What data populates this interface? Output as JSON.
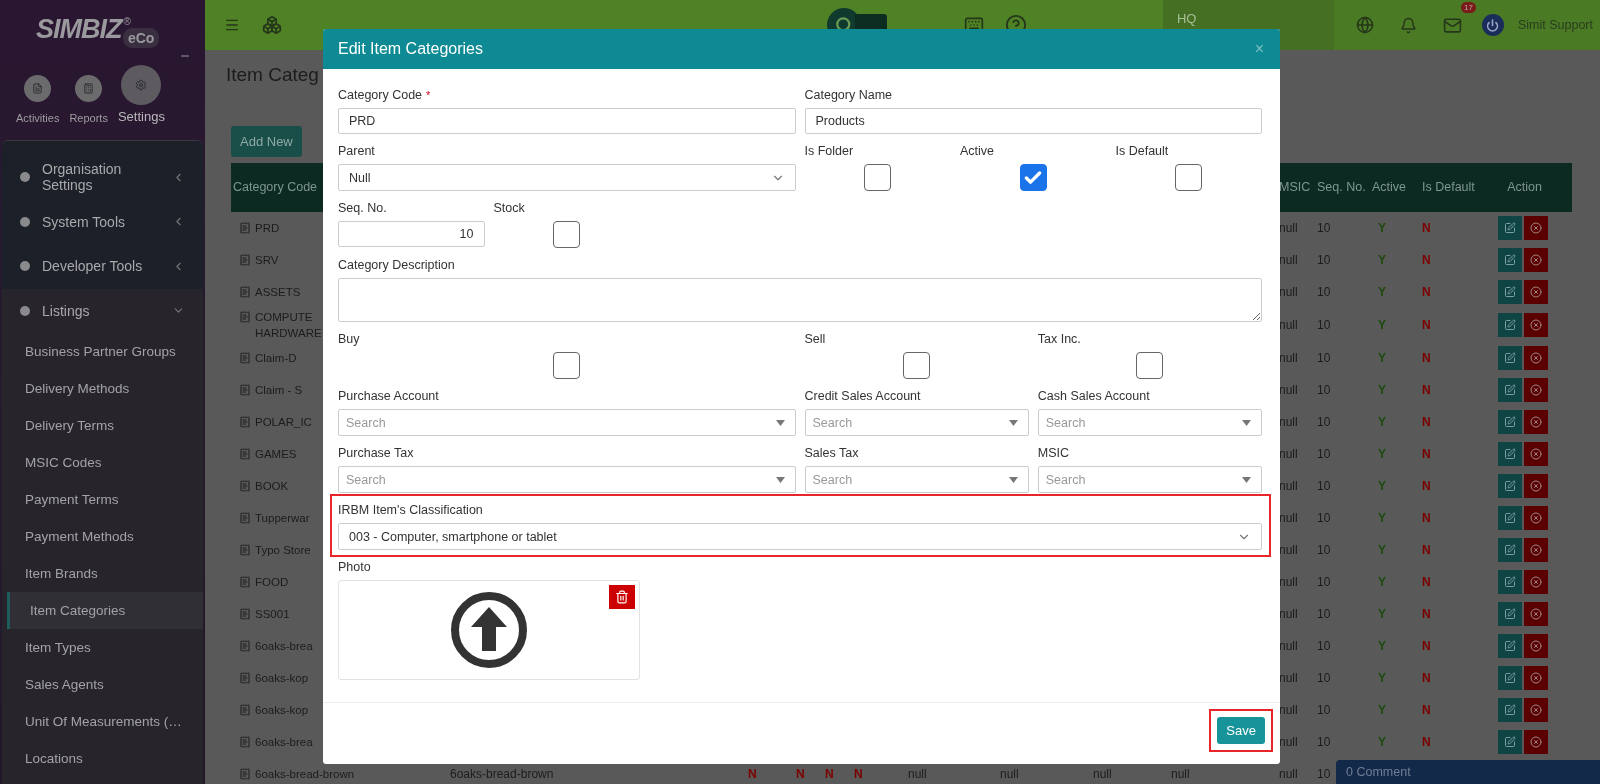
{
  "sidebar": {
    "logo": {
      "name": "SIMBIZ",
      "mark": "®",
      "suffix": "eCo"
    },
    "modules": [
      {
        "label": "Activities",
        "selected": false
      },
      {
        "label": "Reports",
        "selected": false
      },
      {
        "label": "Settings",
        "selected": true
      }
    ],
    "menu": [
      {
        "label": "Organisation Settings",
        "expanded": false
      },
      {
        "label": "System Tools",
        "expanded": false
      },
      {
        "label": "Developer Tools",
        "expanded": false
      },
      {
        "label": "Listings",
        "expanded": true,
        "children": [
          {
            "label": "Business Partner Groups",
            "selected": false
          },
          {
            "label": "Delivery Methods",
            "selected": false
          },
          {
            "label": "Delivery Terms",
            "selected": false
          },
          {
            "label": "MSIC Codes",
            "selected": false
          },
          {
            "label": "Payment Terms",
            "selected": false
          },
          {
            "label": "Payment Methods",
            "selected": false
          },
          {
            "label": "Item Brands",
            "selected": false
          },
          {
            "label": "Item Categories",
            "selected": true
          },
          {
            "label": "Item Types",
            "selected": false
          },
          {
            "label": "Sales Agents",
            "selected": false
          },
          {
            "label": "Unit Of Measurements (…",
            "selected": false
          },
          {
            "label": "Locations",
            "selected": false
          }
        ]
      }
    ]
  },
  "topbar": {
    "location": "HQ",
    "mail_count": "17",
    "user": "Simit Support"
  },
  "page": {
    "title": "Item Categ",
    "add_button": "Add New"
  },
  "table": {
    "columns": [
      "Category Code",
      "MSIC",
      "Seq. No.",
      "Active",
      "Is Default",
      "Action"
    ],
    "rows": [
      {
        "kind": "partial",
        "code": "PRD",
        "msic": "null",
        "seq": "10",
        "active": "Y",
        "is_default": "N"
      },
      {
        "kind": "partial",
        "code": "SRV",
        "msic": "null",
        "seq": "10",
        "active": "Y",
        "is_default": "N"
      },
      {
        "kind": "partial",
        "code": "ASSETS",
        "msic": "null",
        "seq": "10",
        "active": "Y",
        "is_default": "N"
      },
      {
        "kind": "partial",
        "code": "COMPUTE HARDWARE",
        "msic": "null",
        "seq": "10",
        "active": "Y",
        "is_default": "N"
      },
      {
        "kind": "partial",
        "code": "Claim-D",
        "msic": "null",
        "seq": "10",
        "active": "Y",
        "is_default": "N"
      },
      {
        "kind": "partial",
        "code": "Claim - S",
        "msic": "null",
        "seq": "10",
        "active": "Y",
        "is_default": "N"
      },
      {
        "kind": "partial",
        "code": "POLAR_IC",
        "msic": "null",
        "seq": "10",
        "active": "Y",
        "is_default": "N"
      },
      {
        "kind": "partial",
        "code": "GAMES",
        "msic": "null",
        "seq": "10",
        "active": "Y",
        "is_default": "N"
      },
      {
        "kind": "partial",
        "code": "BOOK",
        "msic": "null",
        "seq": "10",
        "active": "Y",
        "is_default": "N"
      },
      {
        "kind": "partial",
        "code": "Tupperwar",
        "msic": "null",
        "seq": "10",
        "active": "Y",
        "is_default": "N"
      },
      {
        "kind": "partial",
        "code": "Typo Store",
        "msic": "null",
        "seq": "10",
        "active": "Y",
        "is_default": "N"
      },
      {
        "kind": "partial",
        "code": "FOOD",
        "msic": "null",
        "seq": "10",
        "active": "Y",
        "is_default": "N"
      },
      {
        "kind": "partial",
        "code": "SS001",
        "msic": "null",
        "seq": "10",
        "active": "Y",
        "is_default": "N"
      },
      {
        "kind": "partial",
        "code": "6oaks-brea",
        "msic": "null",
        "seq": "10",
        "active": "Y",
        "is_default": "N"
      },
      {
        "kind": "partial",
        "code": "6oaks-kop",
        "msic": "null",
        "seq": "10",
        "active": "Y",
        "is_default": "N"
      },
      {
        "kind": "partial",
        "code": "6oaks-kop",
        "msic": "null",
        "seq": "10",
        "active": "Y",
        "is_default": "N"
      },
      {
        "kind": "partial",
        "code": "6oaks-brea",
        "msic": "null",
        "seq": "10",
        "active": "Y",
        "is_default": "N"
      },
      {
        "kind": "full",
        "code": "6oaks-bread-brown",
        "cells": [
          {
            "kind": "text",
            "text": "6oaks-bread-brown"
          },
          {
            "kind": "flag",
            "text": "N"
          },
          {
            "kind": "flag",
            "text": "N"
          },
          {
            "kind": "flag",
            "text": "N"
          },
          {
            "kind": "flag",
            "text": "N"
          },
          {
            "kind": "text",
            "text": "null"
          },
          {
            "kind": "text",
            "text": "null"
          },
          {
            "kind": "text",
            "text": "null"
          },
          {
            "kind": "text",
            "text": "null"
          }
        ],
        "msic": "null",
        "seq": "10"
      }
    ]
  },
  "modal": {
    "title": "Edit Item Categories",
    "close": "×",
    "rows": [
      {
        "fields": [
          {
            "kind": "text",
            "label": "Category Code",
            "required_mark": "*",
            "value": "PRD"
          },
          {
            "kind": "text",
            "label": "Category Name",
            "value": "Products"
          }
        ]
      },
      {
        "fields": [
          {
            "kind": "select",
            "label": "Parent",
            "value": "Null"
          },
          {
            "kind": "checkbox",
            "label": "Is Folder",
            "checked": false
          },
          {
            "kind": "checkbox",
            "label": "Active",
            "checked": true
          },
          {
            "kind": "checkbox",
            "label": "Is Default",
            "checked": false
          }
        ]
      },
      {
        "fields": [
          {
            "kind": "number",
            "label": "Seq. No.",
            "value": "10"
          },
          {
            "kind": "checkbox",
            "label": "Stock",
            "checked": false
          }
        ]
      },
      {
        "fields": [
          {
            "kind": "textarea",
            "label": "Category Description"
          }
        ]
      },
      {
        "fields": [
          {
            "kind": "checkbox",
            "label": "Buy",
            "checked": false
          },
          {
            "kind": "checkbox",
            "label": "Sell",
            "checked": false
          },
          {
            "kind": "checkbox",
            "label": "Tax Inc.",
            "checked": false
          }
        ]
      },
      {
        "fields": [
          {
            "kind": "search",
            "label": "Purchase Account",
            "placeholder": "Search"
          },
          {
            "kind": "search",
            "label": "Credit Sales Account",
            "placeholder": "Search"
          },
          {
            "kind": "search",
            "label": "Cash Sales Account",
            "placeholder": "Search"
          }
        ]
      },
      {
        "fields": [
          {
            "kind": "search",
            "label": "Purchase Tax",
            "placeholder": "Search"
          },
          {
            "kind": "search",
            "label": "Sales Tax",
            "placeholder": "Search"
          },
          {
            "kind": "search",
            "label": "MSIC",
            "placeholder": "Search"
          }
        ]
      },
      {
        "highlighted": true,
        "fields": [
          {
            "kind": "select",
            "label": "IRBM Item's Classification",
            "value": "003 - Computer, smartphone or tablet"
          }
        ]
      },
      {
        "fields": [
          {
            "kind": "photo",
            "label": "Photo"
          }
        ]
      }
    ],
    "footer": {
      "save": "Save",
      "highlighted": true
    }
  },
  "comment_bar": "0 Comment"
}
